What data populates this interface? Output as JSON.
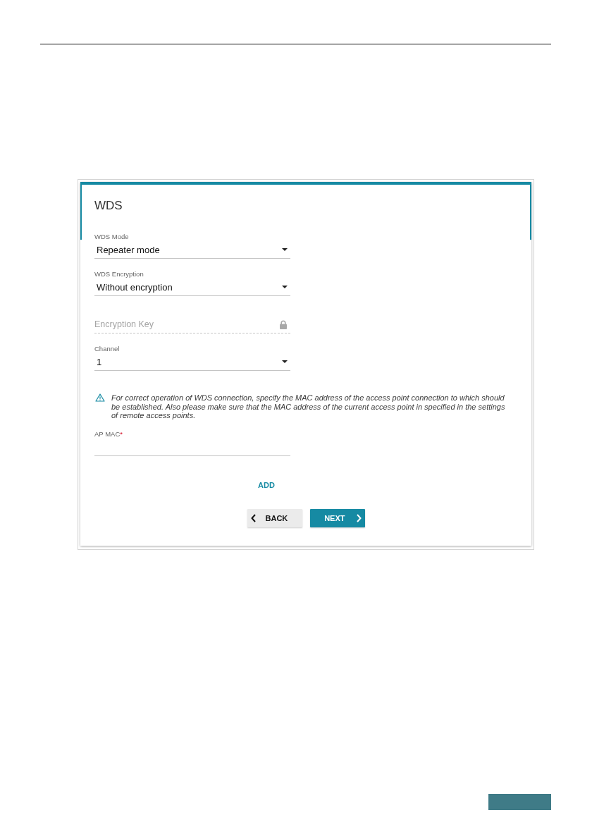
{
  "wizard": {
    "title": "WDS",
    "items": [
      {
        "kind": "select",
        "label": "WDS Mode",
        "value": "Repeater mode"
      },
      {
        "kind": "select",
        "label": "WDS Encryption",
        "value": "Without encryption"
      },
      {
        "kind": "password",
        "placeholder": "Encryption Key",
        "disabled": true
      },
      {
        "kind": "select",
        "label": "Channel",
        "value": "1"
      },
      {
        "kind": "notice",
        "text": "For correct operation of WDS connection, specify the MAC address of the access point connection to which should be established. Also please make sure that the MAC address of the current access point in specified in the settings of remote access points."
      },
      {
        "kind": "text",
        "label": "AP MAC",
        "required_mark": "*"
      }
    ],
    "add_link": "ADD",
    "buttons": [
      {
        "kind": "back",
        "label": "BACK"
      },
      {
        "kind": "next",
        "label": "NEXT"
      }
    ]
  }
}
